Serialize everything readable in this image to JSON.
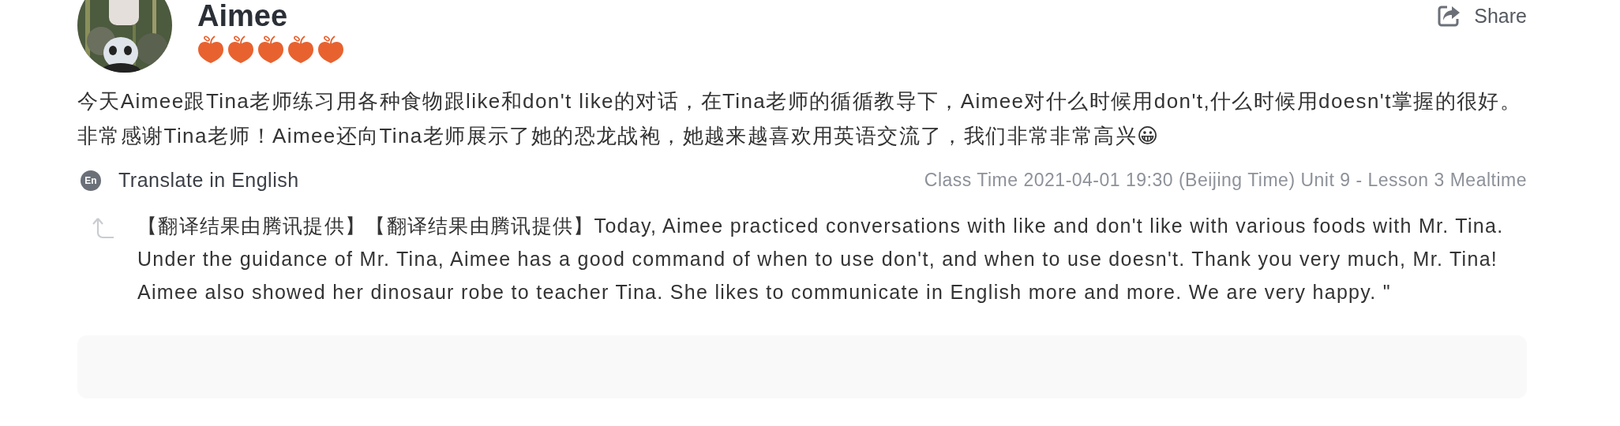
{
  "profile": {
    "name": "Aimee",
    "stars": 5
  },
  "share": {
    "label": "Share"
  },
  "comment": "今天Aimee跟Tina老师练习用各种食物跟like和don't like的对话，在Tina老师的循循教导下，Aimee对什么时候用don't,什么时候用doesn't掌握的很好。非常感谢Tina老师！Aimee还向Tina老师展示了她的恐龙战袍，她越来越喜欢用英语交流了，我们非常非常高兴😀",
  "translate": {
    "badge": "En",
    "label": "Translate in English"
  },
  "class_info": "Class Time 2021-04-01 19:30 (Beijing Time) Unit 9 - Lesson 3 Mealtime",
  "translation": "【翻译结果由腾讯提供】【翻译结果由腾讯提供】Today, Aimee practiced conversations with like and don't like with various foods with Mr. Tina. Under the guidance of Mr. Tina, Aimee has a good command of when to use don't, and when to use doesn't. Thank you very much, Mr. Tina! Aimee also showed her dinosaur robe to teacher Tina. She likes to communicate in English more and more. We are very happy. \""
}
